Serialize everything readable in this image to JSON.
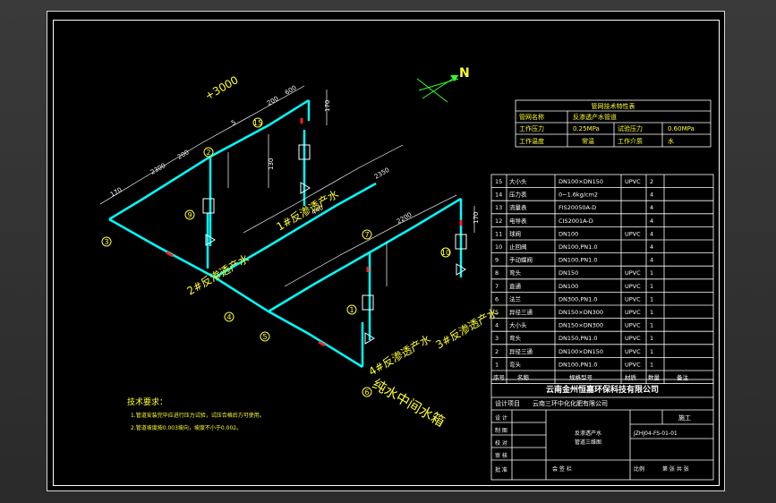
{
  "north_label": "N",
  "elevation": "+3000",
  "notes": {
    "title": "技术要求：",
    "line1": "1.管道安装完毕应进行压力试验，试压合格后方可使用。",
    "line2": "2.管道坡度按0.003坡向，坡度不小于0.002。"
  },
  "labels": {
    "clean_water": "纯水中间水箱",
    "pipe_1": "1#反渗透产水",
    "pipe_2": "2#反渗透产水",
    "pipe_3": "3#反渗透产水",
    "pipe_4": "4#反渗透产水"
  },
  "spec_table": {
    "title": "管网技术特性表",
    "r1": [
      "管网名称",
      "反渗透产水管道"
    ],
    "r2": [
      "工作压力",
      "0.25MPa",
      "试验压力",
      "0.60MPa"
    ],
    "r3": [
      "工作温度",
      "常温",
      "工作介质",
      "水"
    ]
  },
  "bom": {
    "rows": [
      [
        "15",
        "大小头",
        "DN100×DN150",
        "UPVC",
        "2"
      ],
      [
        "14",
        "压力表",
        "0~1.6kg/cm2",
        "",
        "4"
      ],
      [
        "13",
        "流量表",
        "FIS20050A-D",
        "",
        "4"
      ],
      [
        "12",
        "电导表",
        "CIS2001A-D",
        "",
        "4"
      ],
      [
        "11",
        "球阀",
        "DN100",
        "UPVC",
        "4"
      ],
      [
        "10",
        "止回阀",
        "DN100,PN1.0",
        "",
        "4"
      ],
      [
        "9",
        "手动蝶阀",
        "DN100,PN1.0",
        "",
        "4"
      ],
      [
        "8",
        "弯头",
        "DN150",
        "UPVC",
        "1"
      ],
      [
        "7",
        "直通",
        "DN100",
        "UPVC",
        "1"
      ],
      [
        "6",
        "法兰",
        "DN300,PN1.0",
        "UPVC",
        "1"
      ],
      [
        "5",
        "异径三通",
        "DN150×DN300",
        "UPVC",
        "1"
      ],
      [
        "4",
        "大小头",
        "DN150×DN300",
        "UPVC",
        "1"
      ],
      [
        "3",
        "弯头",
        "DN150,PN1.0",
        "UPVC",
        "1"
      ],
      [
        "2",
        "异径三通",
        "DN100×DN150",
        "UPVC",
        "1"
      ],
      [
        "1",
        "弯头",
        "DN100,PN1.0",
        "UPVC",
        "1"
      ]
    ],
    "header": [
      "序号",
      "名称",
      "规格型号",
      "材质",
      "数量",
      "备注"
    ]
  },
  "title_block": {
    "company": "云南金州恒嘉环保科技有限公司",
    "project_label": "设计项目",
    "project": "云南三环中化化肥有限公司",
    "drawing_name_1": "反渗透产水",
    "drawing_name_2": "管道三维图",
    "phase": "施工",
    "drawing_no": "JZHJ04-FS-01-01",
    "scale_label": "比例",
    "date_label": "日期",
    "sheet_label": "第 张 共 张",
    "rows_left": [
      "设 计",
      "制 图",
      "校 对",
      "审 核",
      "批 准"
    ],
    "bottom": "会 签 栏"
  },
  "dims": {
    "d170a": "170",
    "d2300": "2300",
    "d200": "200",
    "d5": "5",
    "d200b": "200",
    "d600": "600",
    "d170b": "170",
    "d130": "130",
    "d440": "440",
    "d2350": "2350",
    "d2200": "2200",
    "d170c": "170"
  },
  "callouts": {
    "c1": "1",
    "c2": "2",
    "c3": "3",
    "c4": "4",
    "c5": "5",
    "c6": "6",
    "c7": "7",
    "c15": "15",
    "c9": "9",
    "c10": "10",
    "c11": "11",
    "c12": "12",
    "c13": "13",
    "c14": "14"
  },
  "colors": {
    "pipe": "#00ffff",
    "text": "#ffff33",
    "line": "#ffffff",
    "red": "#ff2020",
    "green": "#33ff33",
    "valve": "#ff3399"
  }
}
